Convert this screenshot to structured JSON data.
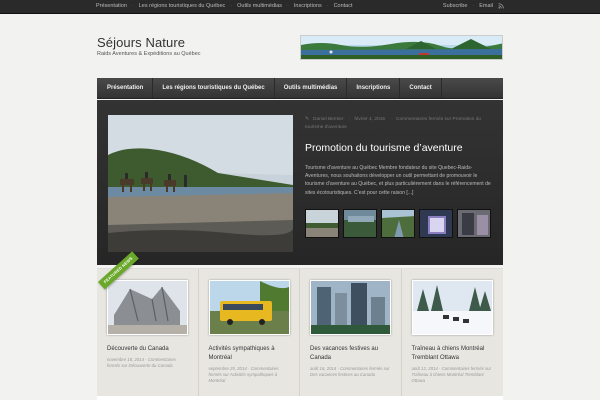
{
  "topnav": {
    "items": [
      "Présentation",
      "Les régions touristiques du Québec",
      "Outils multimédias",
      "Inscriptions",
      "Contact"
    ],
    "subscribe_label": "Subscribe",
    "email_label": "Email"
  },
  "header": {
    "title": "Séjours Nature",
    "tagline": "Raids Aventures & Expéditions au Québec"
  },
  "mainnav": {
    "items": [
      "Présentation",
      "Les régions touristiques du Québec",
      "Outils multimédias",
      "Inscriptions",
      "Contact"
    ]
  },
  "featured": {
    "author": "Daniel Bernier",
    "date": "février 4, 2015",
    "comments": "Commentaires fermés sur Promotion du tourisme d'aventure",
    "title": "Promotion du tourisme d’aventure",
    "excerpt": "Tourisme d’aventure au Québec Membre fondateur du site Quebec-Raids-Aventures, nous souhaitons développer un outil permettant de promouvoir le tourisme d’aventure au Québec, et plus particulièrement dans le référencement de sites écotouristiques. C’est pour cette raison [...]"
  },
  "ribbon": "FEATURED NEWS",
  "cards": [
    {
      "title": "Découverte du Canada",
      "date": "novembre 18, 2014",
      "meta": "Commentaires fermés sur Découverte du Canada"
    },
    {
      "title": "Activités sympathiques à Montréal",
      "date": "septembre 25, 2014",
      "meta": "Commentaires fermés sur Activités sympathiques à Montréal"
    },
    {
      "title": "Des vacances festives au Canada",
      "date": "août 16, 2014",
      "meta": "Commentaires fermés sur Des vacances festives au Canada"
    },
    {
      "title": "Traîneau à chiens Montréal Tremblant Ottawa",
      "date": "août 12, 2014",
      "meta": "Commentaires fermés sur Traîneau à chiens Montréal Tremblant Ottawa"
    }
  ]
}
